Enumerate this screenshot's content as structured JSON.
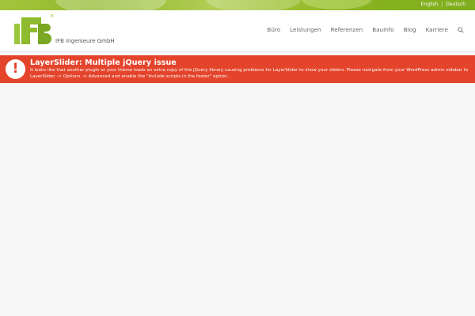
{
  "colors": {
    "accent_green": "#8dbb2d",
    "alert_red": "#e4442b",
    "nav_text": "#666666",
    "page_bg": "#f7f7f7"
  },
  "top_bar": {
    "languages": [
      "English",
      "Deutsch"
    ],
    "separator": "|"
  },
  "header": {
    "logo": {
      "text": "IFB Ingenieure GmbH",
      "registered_mark": "®"
    },
    "nav": {
      "items": [
        "Büro",
        "Leistungen",
        "Referenzen",
        "BauInfo",
        "Blog",
        "Karriere"
      ],
      "search_icon": "search-icon"
    }
  },
  "alert": {
    "icon_glyph": "!",
    "title": "LayerSlider: Multiple jQuery issue",
    "message": "It looks like that another plugin or your theme loads an extra copy of the jQuery library causing problems for LayerSlider to show your sliders. Please navigate from your WordPress admin sidebar to LayerSlider -> Options -> Advanced and enable the \"Include scripts in the footer\" option."
  }
}
